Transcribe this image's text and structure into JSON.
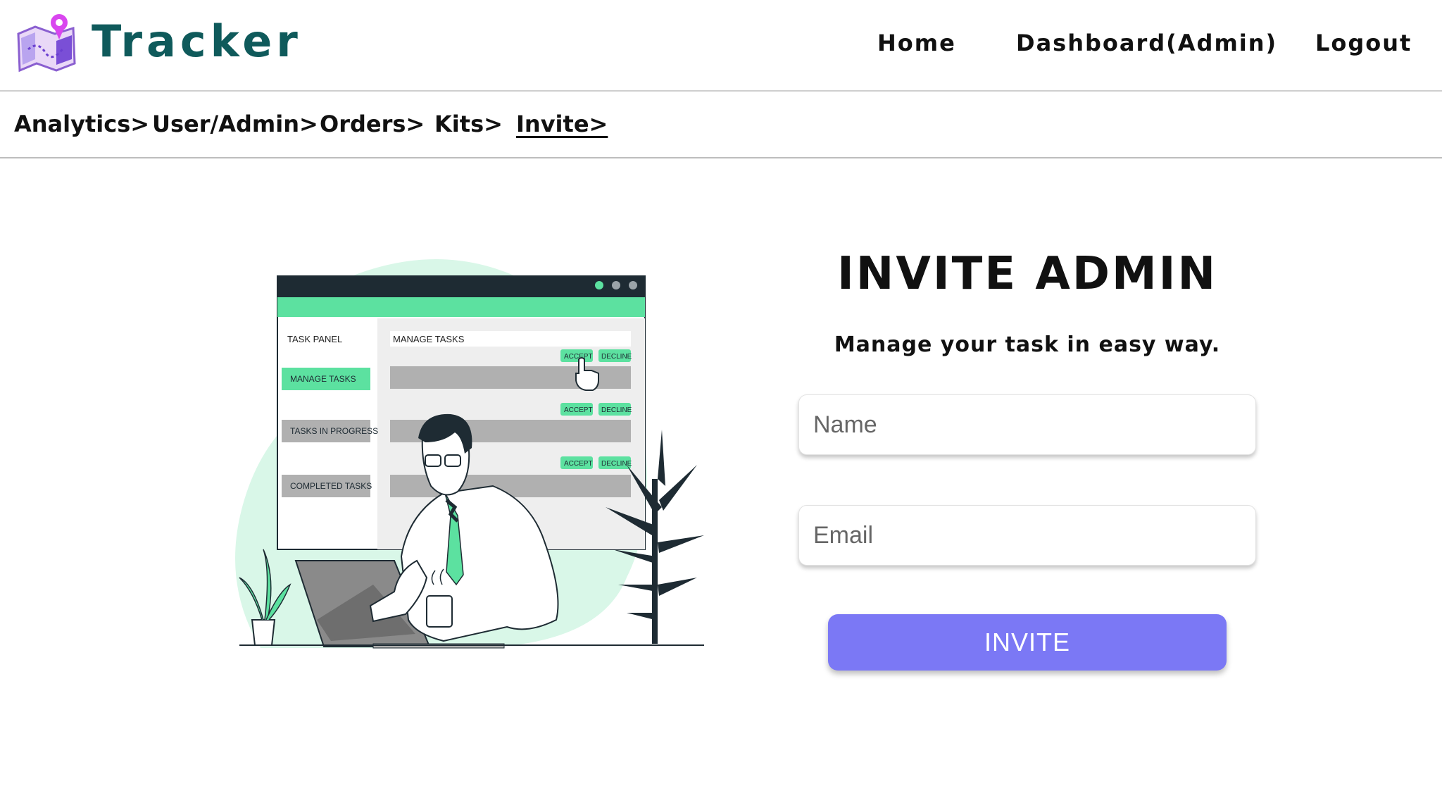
{
  "header": {
    "brand": "Tracker",
    "nav": {
      "home": "Home",
      "dashboard": "Dashboard(Admin)",
      "logout": "Logout"
    }
  },
  "subnav": {
    "analytics": "Analytics>",
    "user_admin": "User/Admin>",
    "orders": "Orders>",
    "kits": "Kits>",
    "invite": "Invite>"
  },
  "illustration": {
    "panel_title": "TASK PANEL",
    "manage_tasks_header": "MANAGE TASKS",
    "sidebar": [
      "MANAGE TASKS",
      "TASKS IN PROGRESS",
      "COMPLETED TASKS"
    ],
    "accept": "ACCEPT",
    "decline": "DECLINE"
  },
  "form": {
    "title": "INVITE ADMIN",
    "subtitle": "Manage your task in easy way.",
    "name_placeholder": "Name",
    "email_placeholder": "Email",
    "submit_label": "INVITE"
  },
  "colors": {
    "brand": "#0f5a5b",
    "accent_green": "#5ce1a0",
    "button": "#7b78f5"
  }
}
